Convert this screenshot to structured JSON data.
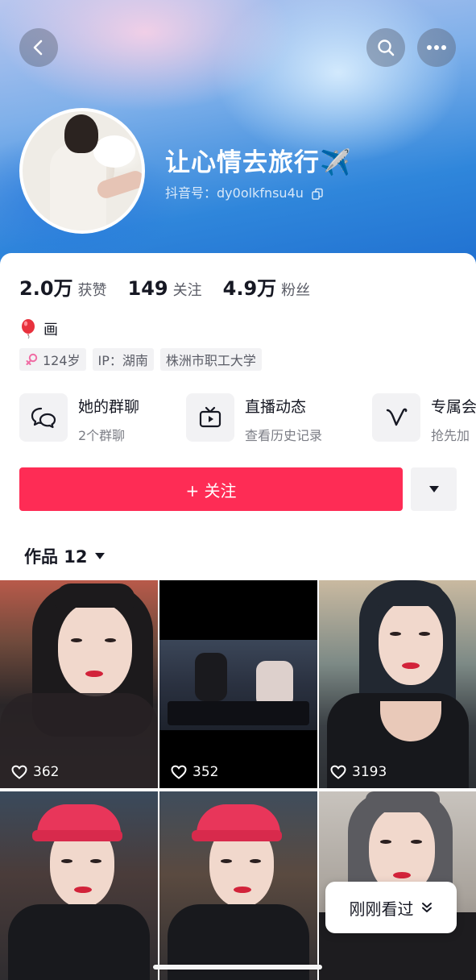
{
  "profile": {
    "name": "让心情去旅行✈️",
    "id_label": "抖音号：",
    "id_value": "dy0olkfnsu4u"
  },
  "stats": [
    {
      "num": "2.0万",
      "label": "获赞"
    },
    {
      "num": "149",
      "label": "关注"
    },
    {
      "num": "4.9万",
      "label": "粉丝"
    }
  ],
  "bio": {
    "icon": "balloon-icon",
    "text": "画"
  },
  "tags": {
    "age": "124岁",
    "ip": "IP：湖南",
    "school": "株洲市职工大学"
  },
  "quick_actions": [
    {
      "title": "她的群聊",
      "sub": "2个群聊",
      "icon": "group-chat-icon"
    },
    {
      "title": "直播动态",
      "sub": "查看历史记录",
      "icon": "tv-icon"
    },
    {
      "title": "专属会",
      "sub": "抢先加",
      "icon": "v-badge-icon"
    }
  ],
  "follow_label": "+ 关注",
  "works": {
    "label": "作品 12"
  },
  "videos": [
    {
      "likes": "362"
    },
    {
      "likes": "352"
    },
    {
      "likes": "3193"
    }
  ],
  "recent_label": "刚刚看过",
  "colors": {
    "accent": "#fe2c55",
    "header_blue": "#2f86db",
    "tag_bg": "#f2f2f4"
  }
}
